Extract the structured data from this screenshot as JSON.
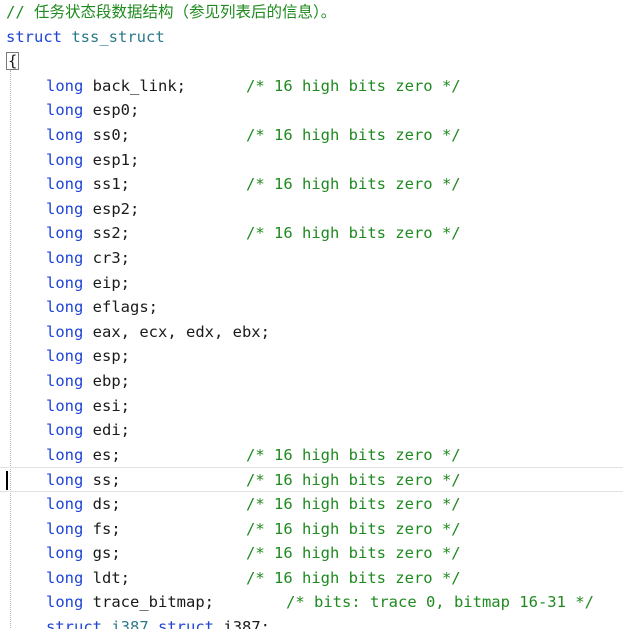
{
  "editor": {
    "header_comment": "// 任务状态段数据结构（参见列表后的信息）。",
    "struct_keyword": "struct",
    "struct_name": "tss_struct",
    "open_brace": "{",
    "type_keyword": "long",
    "fields": [
      {
        "name": "back_link;",
        "comment": "/* 16 high bits zero */"
      },
      {
        "name": "esp0;",
        "comment": ""
      },
      {
        "name": "ss0;",
        "comment": "/* 16 high bits zero */"
      },
      {
        "name": "esp1;",
        "comment": ""
      },
      {
        "name": "ss1;",
        "comment": "/* 16 high bits zero */"
      },
      {
        "name": "esp2;",
        "comment": ""
      },
      {
        "name": "ss2;",
        "comment": "/* 16 high bits zero */"
      },
      {
        "name": "cr3;",
        "comment": ""
      },
      {
        "name": "eip;",
        "comment": ""
      },
      {
        "name": "eflags;",
        "comment": ""
      },
      {
        "name": "eax, ecx, edx, ebx;",
        "comment": ""
      },
      {
        "name": "esp;",
        "comment": ""
      },
      {
        "name": "ebp;",
        "comment": ""
      },
      {
        "name": "esi;",
        "comment": ""
      },
      {
        "name": "edi;",
        "comment": ""
      },
      {
        "name": "es;",
        "comment": "/* 16 high bits zero */"
      },
      {
        "name": "ss;",
        "comment": "/* 16 high bits zero */"
      },
      {
        "name": "ds;",
        "comment": "/* 16 high bits zero */"
      },
      {
        "name": "fs;",
        "comment": "/* 16 high bits zero */"
      },
      {
        "name": "gs;",
        "comment": "/* 16 high bits zero */"
      },
      {
        "name": "ldt;",
        "comment": "/* 16 high bits zero */"
      },
      {
        "name": "trace_bitmap;",
        "comment": "/* bits: trace 0, bitmap 16-31 */"
      }
    ],
    "last_line": {
      "kw1": "struct",
      "type1": "i387",
      "kw2": "struct",
      "name": "i387;"
    },
    "colors": {
      "keyword": "#1f44d6",
      "type_name": "#2b7a8c",
      "comment": "#1f8a1f",
      "text": "#1a1a1a",
      "background": "#ffffff"
    }
  }
}
